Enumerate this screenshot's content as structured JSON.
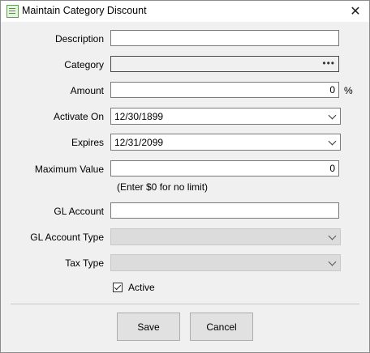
{
  "window": {
    "title": "Maintain Category Discount",
    "close_glyph": "✕"
  },
  "form": {
    "description": {
      "label": "Description",
      "value": ""
    },
    "category": {
      "label": "Category",
      "value": "",
      "browse_glyph": "•••"
    },
    "amount": {
      "label": "Amount",
      "value": "0",
      "unit": "%"
    },
    "activate_on": {
      "label": "Activate On",
      "value": "12/30/1899"
    },
    "expires": {
      "label": "Expires",
      "value": "12/31/2099"
    },
    "maximum_value": {
      "label": "Maximum Value",
      "value": "0",
      "hint": "(Enter $0 for no limit)"
    },
    "gl_account": {
      "label": "GL Account",
      "value": ""
    },
    "gl_account_type": {
      "label": "GL Account Type",
      "value": ""
    },
    "tax_type": {
      "label": "Tax Type",
      "value": ""
    },
    "active": {
      "label": "Active",
      "checked": true
    }
  },
  "buttons": {
    "save": "Save",
    "cancel": "Cancel"
  }
}
